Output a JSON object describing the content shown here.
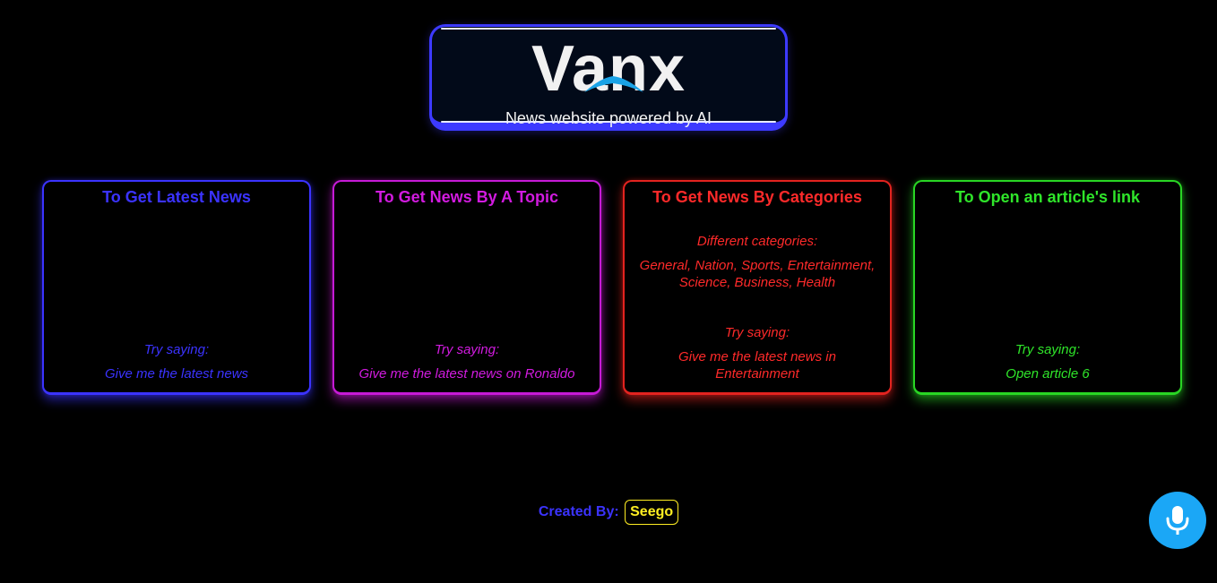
{
  "header": {
    "logo_text": "Vanx",
    "subtitle": "News website powered by AI"
  },
  "colors": {
    "background": "#000000",
    "blue": "#3b33ff",
    "purple": "#d21be0",
    "red": "#ff2a2a",
    "green": "#2fe52a",
    "footer_name": "#ffee22",
    "mic_button": "#1ba7f6"
  },
  "cards": [
    {
      "title": "To Get Latest News",
      "try_label": "Try saying:",
      "example": "Give me the latest news"
    },
    {
      "title": "To Get News By A Topic",
      "try_label": "Try saying:",
      "example": "Give me the latest news on Ronaldo"
    },
    {
      "title": "To Get News By Categories",
      "categories_label": "Different categories:",
      "categories": "General, Nation, Sports, Entertainment, Science, Business, Health",
      "try_label": "Try saying:",
      "example": "Give me the latest news in Entertainment"
    },
    {
      "title": "To Open an article's link",
      "try_label": "Try saying:",
      "example": "Open article 6"
    }
  ],
  "footer": {
    "label": "Created By:",
    "name": "Seego"
  },
  "mic": {
    "icon": "microphone-icon"
  }
}
